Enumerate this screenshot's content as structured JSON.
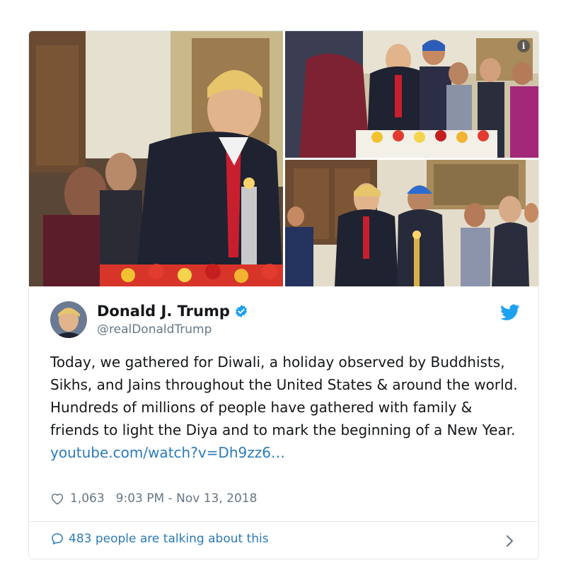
{
  "media": {
    "photos": [
      {
        "name": "diwali-photo-candle-lighting"
      },
      {
        "name": "diwali-photo-group-left"
      },
      {
        "name": "diwali-photo-group-right"
      }
    ],
    "info_icon": "info-icon"
  },
  "author": {
    "display_name": "Donald J. Trump",
    "handle": "@realDonaldTrump",
    "verified_icon": "verified-badge-icon",
    "platform_icon": "twitter-bird-icon"
  },
  "tweet": {
    "text": "Today, we gathered for Diwali, a holiday observed by Buddhists, Sikhs, and Jains throughout the United States & around the world. Hundreds of millions of people have gathered with family & friends to light the Diya and to mark the beginning of a New Year.",
    "link": "youtube.com/watch?v=Dh9zz6…"
  },
  "meta": {
    "likes": "1,063",
    "timestamp": "9:03 PM - Nov 13, 2018"
  },
  "footer": {
    "talking": "483 people are talking about this"
  },
  "colors": {
    "link": "#2b7bb9",
    "muted": "#657786",
    "border": "#e1e8ed",
    "verified": "#1da1f2"
  }
}
